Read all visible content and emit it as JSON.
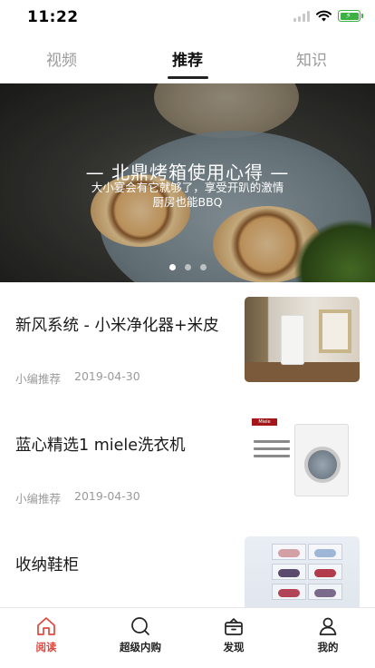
{
  "status_bar": {
    "time": "11:22"
  },
  "tabs": [
    {
      "label": "视频",
      "active": false
    },
    {
      "label": "推荐",
      "active": true
    },
    {
      "label": "知识",
      "active": false
    }
  ],
  "banner": {
    "title": "— 北鼎烤箱使用心得 —",
    "subtitle_line1": "大小宴会有它就够了，享受开趴的激情",
    "subtitle_line2": "厨房也能BBQ",
    "slide_count": 3,
    "active_slide": 1
  },
  "articles": [
    {
      "title": "新风系统 - 小米净化器+米皮",
      "author": "小编推荐",
      "date": "2019-04-30"
    },
    {
      "title": "蓝心精选1 miele洗衣机",
      "author": "小编推荐",
      "date": "2019-04-30",
      "thumb_brand": "Miele"
    },
    {
      "title": "收纳鞋柜"
    }
  ],
  "bottom_nav": [
    {
      "label": "阅读",
      "icon": "home-icon",
      "active": true
    },
    {
      "label": "超级内购",
      "icon": "search-icon",
      "active": false
    },
    {
      "label": "发现",
      "icon": "gift-box-icon",
      "active": false
    },
    {
      "label": "我的",
      "icon": "user-icon",
      "active": false
    }
  ],
  "colors": {
    "accent": "#e0473f",
    "battery": "#3cb043"
  }
}
